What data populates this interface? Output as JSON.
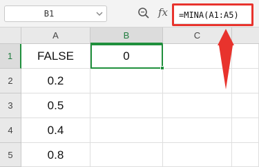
{
  "formula_bar": {
    "name_box": "B1",
    "name_box_dropdown_icon": "chevron-down-icon",
    "zoom_icon": "zoom-search-icon",
    "fx_label": "fx",
    "formula": "=MINA(A1:A5)"
  },
  "sheet": {
    "columns": [
      "A",
      "B",
      "C"
    ],
    "rows": [
      {
        "number": "1",
        "a": "FALSE",
        "b": "0",
        "c": ""
      },
      {
        "number": "2",
        "a": "0.2",
        "b": "",
        "c": ""
      },
      {
        "number": "3",
        "a": "0.5",
        "b": "",
        "c": ""
      },
      {
        "number": "4",
        "a": "0.4",
        "b": "",
        "c": ""
      },
      {
        "number": "5",
        "a": "0.8",
        "b": "",
        "c": ""
      }
    ],
    "selected_cell": "B1"
  },
  "annotation": {
    "highlight_color": "#e8332d",
    "arrow_icon": "red-arrow-up-icon"
  },
  "colors": {
    "selection": "#1f8f3c",
    "header_bg": "#e9e9e9"
  }
}
